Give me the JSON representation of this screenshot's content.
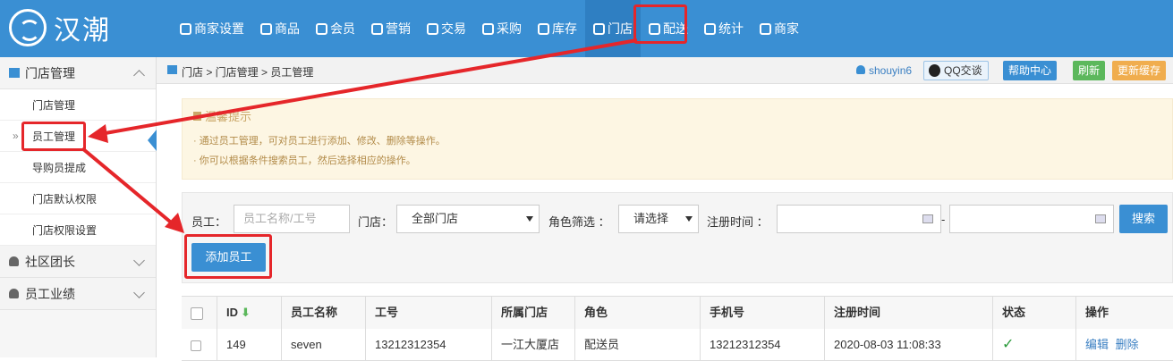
{
  "brand": {
    "name": "汉潮"
  },
  "nav": [
    {
      "label": "商家设置",
      "icon": "gear-icon"
    },
    {
      "label": "商品",
      "icon": "database-icon"
    },
    {
      "label": "会员",
      "icon": "users-icon"
    },
    {
      "label": "营销",
      "icon": "cup-icon"
    },
    {
      "label": "交易",
      "icon": "clipboard-icon"
    },
    {
      "label": "采购",
      "icon": "cup-icon"
    },
    {
      "label": "库存",
      "icon": "warehouse-icon"
    },
    {
      "label": "门店",
      "icon": "home-icon"
    },
    {
      "label": "配送",
      "icon": "truck-icon"
    },
    {
      "label": "统计",
      "icon": "bar-chart-icon"
    },
    {
      "label": "商家",
      "icon": "shop-icon"
    }
  ],
  "sidebar": {
    "groups": [
      {
        "label": "门店管理",
        "icon": "home-icon",
        "items": [
          "门店管理",
          "员工管理",
          "导购员提成",
          "门店默认权限",
          "门店权限设置"
        ]
      },
      {
        "label": "社区团长",
        "icon": "user-icon"
      },
      {
        "label": "员工业绩",
        "icon": "user-icon"
      }
    ],
    "active_marker": "»"
  },
  "breadcrumb": "门店 > 门店管理 > 员工管理",
  "topright": {
    "user": "shouyin6",
    "qq": "QQ交谈",
    "help": "帮助中心",
    "refresh": "刷新",
    "clear_cache": "更新缓存"
  },
  "tips": {
    "title": "温馨提示",
    "lines": [
      "· 通过员工管理，可对员工进行添加、修改、删除等操作。",
      "· 你可以根据条件搜索员工，然后选择相应的操作。"
    ]
  },
  "filter": {
    "employee_label": "员工：",
    "employee_placeholder": "员工名称/工号",
    "store_label": "门店：",
    "store_value": "全部门店",
    "role_label": "角色筛选 ：",
    "role_value": "请选择",
    "date_label": "注册时间 ：",
    "date_sep": "-",
    "search_button": "搜索",
    "add_button": "添加员工"
  },
  "table": {
    "headers": [
      "ID",
      "员工名称",
      "工号",
      "所属门店",
      "角色",
      "手机号",
      "注册时间",
      "状态",
      "操作"
    ],
    "rows": [
      {
        "id": "149",
        "name": "seven",
        "work_no": "13212312354",
        "store": "一江大厦店",
        "role": "配送员",
        "phone": "13212312354",
        "reg_time": "2020-08-03 11:08:33",
        "status": "✓",
        "edit": "编辑",
        "delete": "删除"
      }
    ]
  },
  "colors": {
    "primary": "#3a8fd3",
    "highlight": "#e5262a",
    "tips_bg": "#fdf6e3",
    "refresh": "#5cb85c",
    "cache": "#f0ad4e"
  }
}
